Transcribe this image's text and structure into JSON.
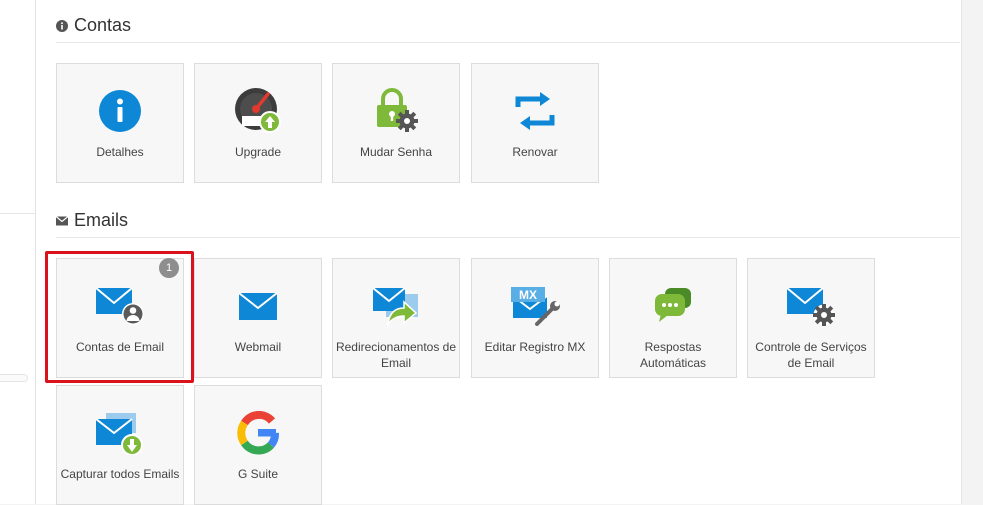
{
  "sections": {
    "contas": {
      "title": "Contas",
      "icon": "info-circle-icon",
      "items": [
        {
          "label": "Detalhes",
          "icon": "info-icon"
        },
        {
          "label": "Upgrade",
          "icon": "speedometer-upgrade-icon"
        },
        {
          "label": "Mudar Senha",
          "icon": "lock-gear-icon"
        },
        {
          "label": "Renovar",
          "icon": "renew-arrows-icon"
        }
      ]
    },
    "emails": {
      "title": "Emails",
      "icon": "envelope-icon",
      "items": [
        {
          "label": "Contas de Email",
          "icon": "email-user-icon",
          "badge": "1",
          "highlighted": true
        },
        {
          "label": "Webmail",
          "icon": "envelope-icon"
        },
        {
          "label": "Redirecionamentos de Email",
          "icon": "email-forward-icon"
        },
        {
          "label": "Editar Registro MX",
          "icon": "email-mx-wrench-icon",
          "mx_text": "MX"
        },
        {
          "label": "Respostas Automáticas",
          "icon": "chat-bubbles-icon"
        },
        {
          "label": "Controle de Serviços de Email",
          "icon": "email-gear-icon"
        },
        {
          "label": "Capturar todos Emails",
          "icon": "email-download-icon"
        },
        {
          "label": "G Suite",
          "icon": "google-g-icon"
        }
      ]
    }
  },
  "colors": {
    "accent_blue": "#0d87d6",
    "green": "#7fb93a",
    "highlight_red": "#d9121c",
    "badge_gray": "#8e8e8e",
    "tile_bg": "#f7f7f7"
  }
}
